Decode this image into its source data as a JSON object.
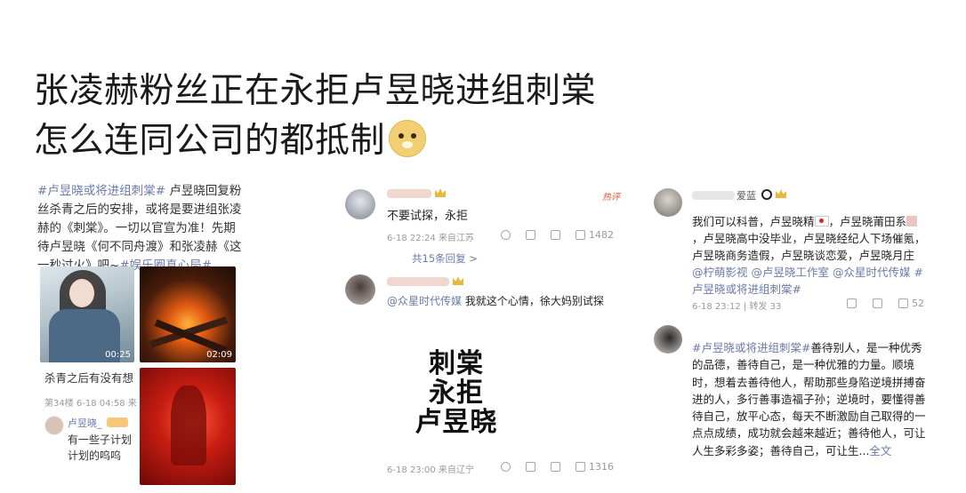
{
  "heading": {
    "line1": "张凌赫粉丝正在永拒卢昱晓进组刺棠",
    "line2": "怎么连同公司的都抵制"
  },
  "left_post": {
    "text_tag1": "#卢昱晓或将进组刺棠#",
    "text_body": " 卢昱晓回复粉丝杀青之后的安排，或将是要进组张凌赫的《刺棠》。一切以官宣为准！先期待卢昱晓《何不同舟渡》和张凌赫《这一秒过火》吧~",
    "text_tag2": "#娱乐圈真心局#",
    "video1_duration": "00:25",
    "video2_duration": "02:09",
    "caption": "杀青之后有没有想",
    "floor_meta": "第34楼 6-18 04:58 来",
    "reply_user": "卢昱晓_",
    "reply_text": "有一些子计划计划的呜呜"
  },
  "middle_post": {
    "comment1_text": "不要试探，永拒",
    "comment1_meta": "6-18 22:24 来自江苏",
    "comment1_likes": "1482",
    "hot_badge": "热评",
    "replies_link": "共15条回复 >",
    "reply_mention": "@众星时代传媒",
    "reply_text": " 我就这个心情，徐大妈别试探",
    "big_line1": "刺棠",
    "big_line2": "永拒",
    "big_line3": "卢昱晓",
    "comment2_meta": "6-18 23:00 来自辽宁",
    "comment2_likes": "1316"
  },
  "right_post": {
    "user_name": "爱蓝",
    "comment_text_a": "我们可以科普，卢昱晓精",
    "comment_text_b": "，卢昱晓莆田系",
    "comment_text_c": "，卢昱晓高中没毕业，卢昱晓经纪人下场催氪，卢昱晓商务造假，卢昱晓谈恋爱，卢昱晓月庄 ",
    "mention1": "@柠萌影视",
    "mention2": "@卢昱晓工作室",
    "mention3": "@众星时代传媒",
    "tag": "#卢昱晓或将进组刺棠#",
    "meta": "6-18 23:12 | 转发 33",
    "likes": "52",
    "post2_tag": "#卢昱晓或将进组刺棠#",
    "post2_text": "善待别人，是一种优秀的品德，善待自己，是一种优雅的力量。顺境时，想着去善待他人，帮助那些身陷逆境拼搏奋进的人，多行善事造福子孙；逆境时，要懂得善待自己，放平心态，每天不断激励自己取得的一点点成绩，成功就会越来越近；善待他人，可让人生多彩多姿；善待自己，可让生...",
    "full_text_link": "全文"
  },
  "colors": {
    "hashtag": "#6c7ba8",
    "hot": "#e8543a",
    "meta": "#9a9a9a"
  }
}
